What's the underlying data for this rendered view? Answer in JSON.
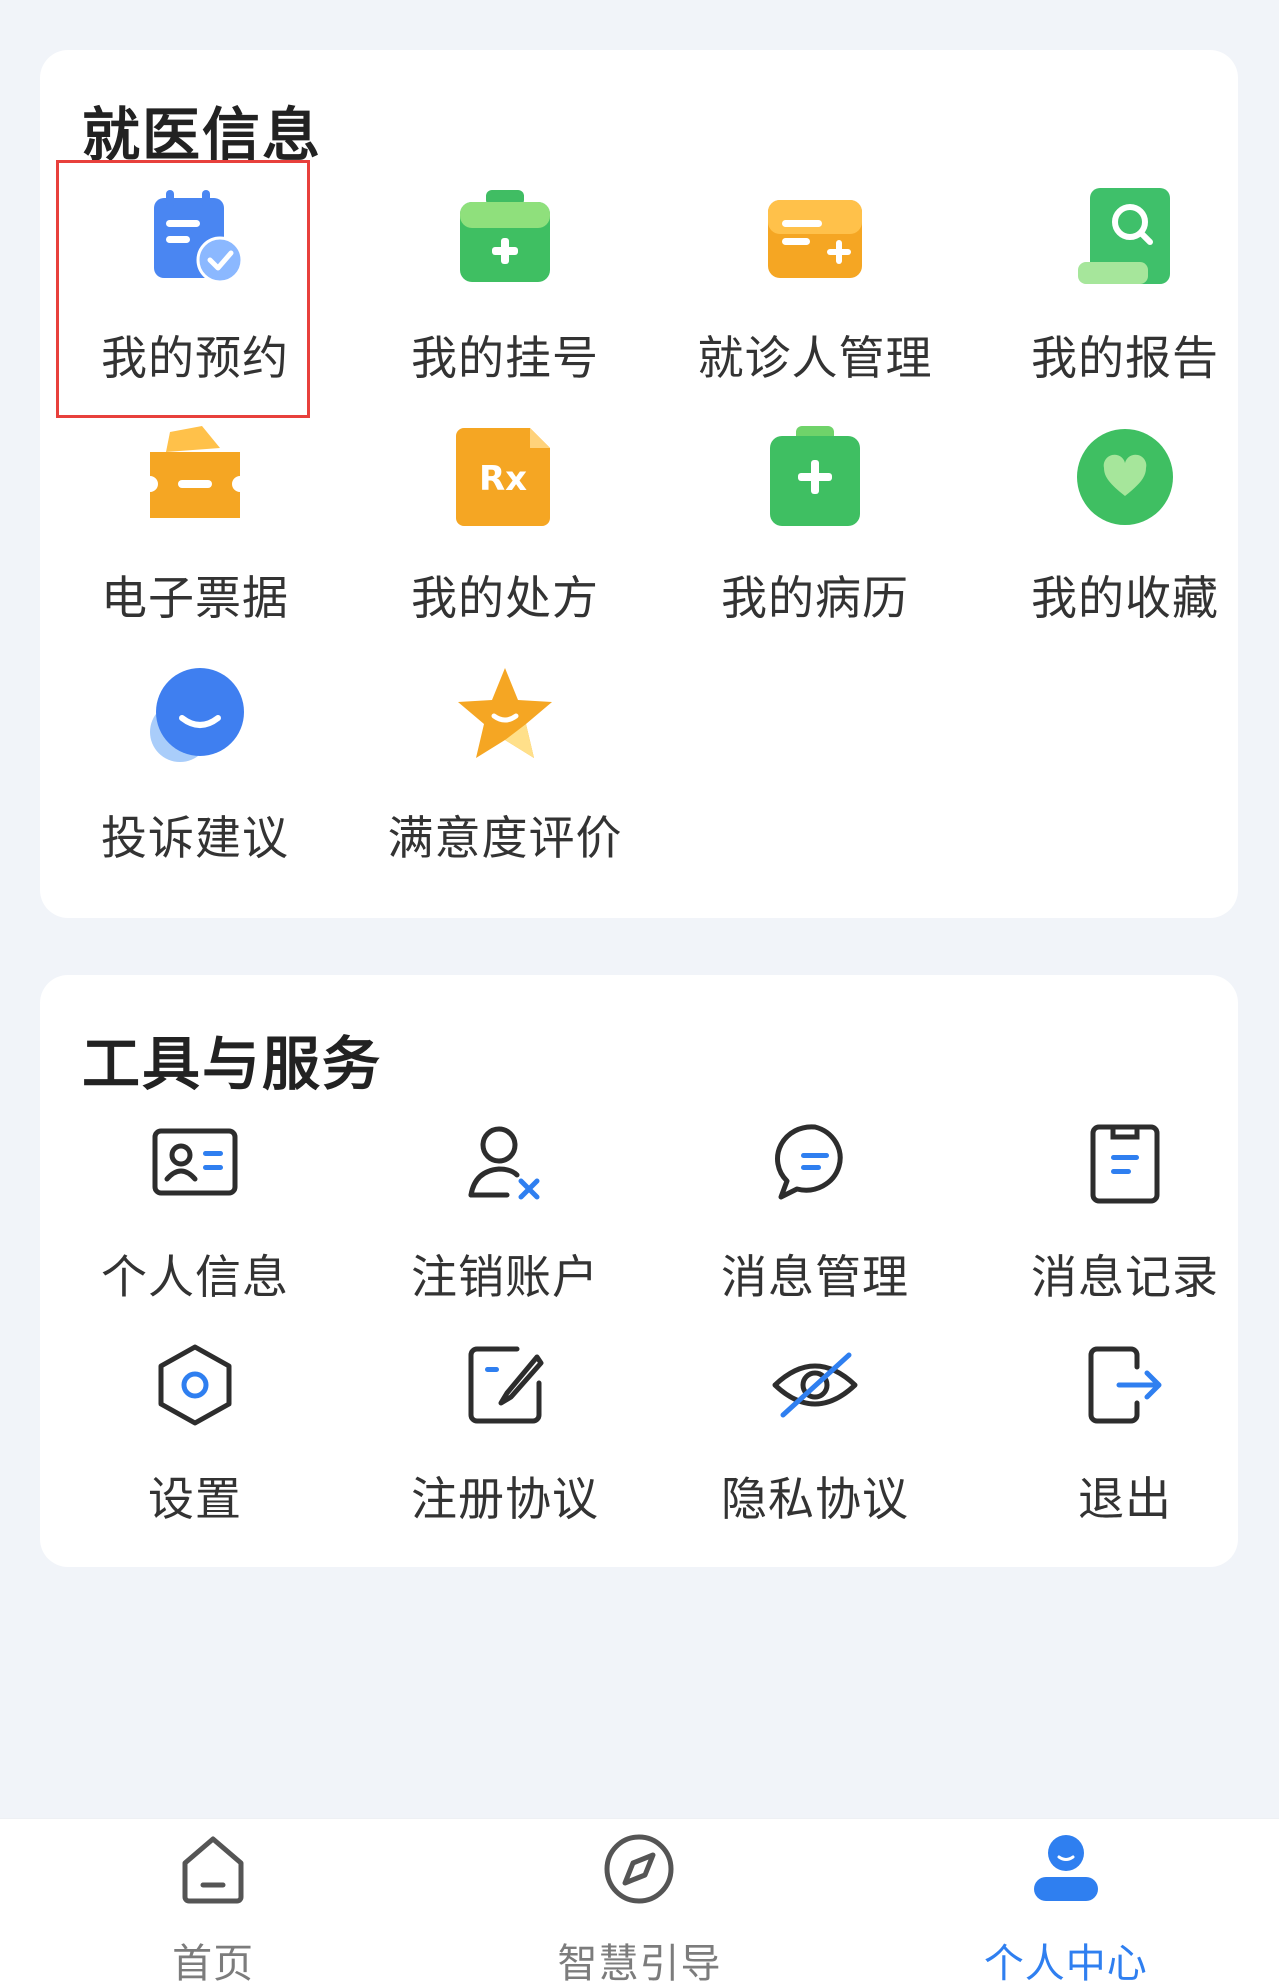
{
  "medical_info": {
    "title": "就医信息",
    "items": [
      {
        "label": "我的预约",
        "icon": "calendar-check-icon"
      },
      {
        "label": "我的挂号",
        "icon": "medical-kit-icon"
      },
      {
        "label": "就诊人管理",
        "icon": "patient-card-icon"
      },
      {
        "label": "我的报告",
        "icon": "report-search-icon"
      },
      {
        "label": "电子票据",
        "icon": "ticket-icon"
      },
      {
        "label": "我的处方",
        "icon": "prescription-icon"
      },
      {
        "label": "我的病历",
        "icon": "medical-record-icon"
      },
      {
        "label": "我的收藏",
        "icon": "heart-icon"
      },
      {
        "label": "投诉建议",
        "icon": "chat-bubble-icon"
      },
      {
        "label": "满意度评价",
        "icon": "star-icon"
      }
    ]
  },
  "tools_services": {
    "title": "工具与服务",
    "items": [
      {
        "label": "个人信息",
        "icon": "id-card-icon"
      },
      {
        "label": "注销账户",
        "icon": "user-remove-icon"
      },
      {
        "label": "消息管理",
        "icon": "message-icon"
      },
      {
        "label": "消息记录",
        "icon": "clipboard-icon"
      },
      {
        "label": "设置",
        "icon": "hexagon-settings-icon"
      },
      {
        "label": "注册协议",
        "icon": "edit-document-icon"
      },
      {
        "label": "隐私协议",
        "icon": "eye-slash-icon"
      },
      {
        "label": "退出",
        "icon": "logout-icon"
      }
    ]
  },
  "tabbar": {
    "tabs": [
      {
        "label": "首页",
        "icon": "home-icon",
        "active": false
      },
      {
        "label": "智慧引导",
        "icon": "compass-icon",
        "active": false
      },
      {
        "label": "个人中心",
        "icon": "user-icon",
        "active": true
      }
    ]
  },
  "colors": {
    "accent": "#2f7ff0",
    "highlight_border": "#e8403c",
    "background": "#f1f4f9"
  }
}
